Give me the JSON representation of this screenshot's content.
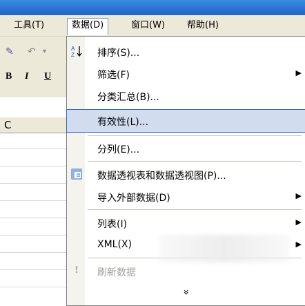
{
  "menubar": {
    "items": [
      {
        "label": "工具(T)"
      },
      {
        "label": "数据(D)"
      },
      {
        "label": "窗口(W)"
      },
      {
        "label": "帮助(H)"
      }
    ]
  },
  "toolbar": {
    "bold": "B",
    "italic": "I",
    "underline": "U",
    "column_header": "C"
  },
  "data_menu": {
    "items": [
      {
        "label": "排序(S)...",
        "icon": "sort-az-icon"
      },
      {
        "label": "筛选(F)",
        "submenu": true
      },
      {
        "label": "分类汇总(B)..."
      },
      {
        "label": "有效性(L)...",
        "highlighted": true
      },
      {
        "label": "分列(E)..."
      },
      {
        "label": "数据透视表和数据透视图(P)...",
        "icon": "pivot-table-icon"
      },
      {
        "label": "导入外部数据(D)",
        "submenu": true
      },
      {
        "label": "列表(I)",
        "submenu": true
      },
      {
        "label": "XML(X)",
        "submenu": true
      },
      {
        "label": "刷新数据",
        "disabled": true,
        "icon": "refresh-icon"
      }
    ],
    "expand_label": "»"
  },
  "colors": {
    "menu_highlight": "#d2dcef",
    "menu_border": "#316ac5",
    "menubar_bg": "#ece9d8"
  }
}
